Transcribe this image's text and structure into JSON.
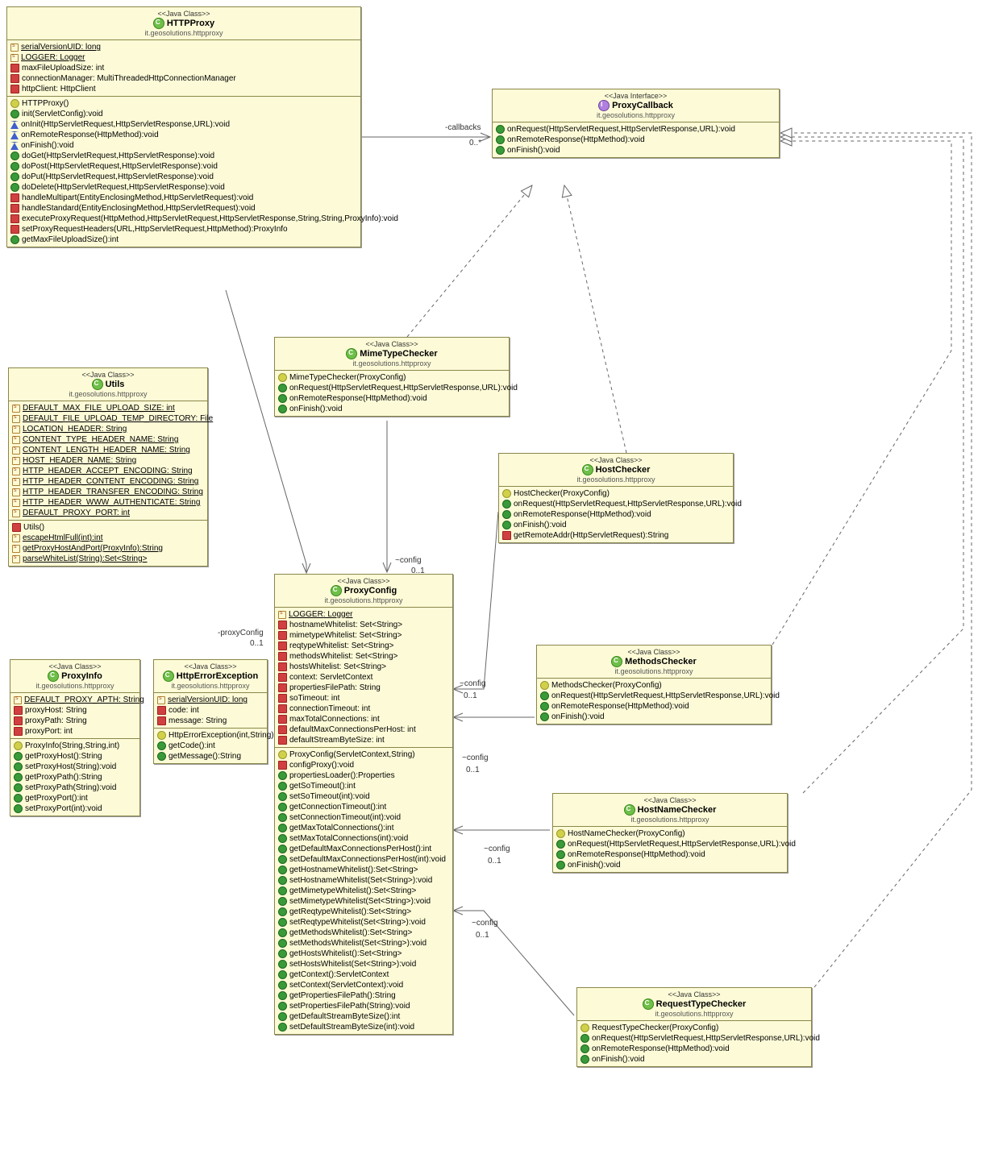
{
  "stereo_class": "<<Java Class>>",
  "stereo_intf": "<<Java Interface>>",
  "pkg": "it.geosolutions.httpproxy",
  "labels": {
    "callbacks": "-callbacks",
    "callbacks_mult": "0..*",
    "proxyConfig": "-proxyConfig",
    "proxyConfig_mult": "0..1",
    "config": "~config",
    "config_mult": "0..1"
  },
  "httpproxy": {
    "name": "HTTPProxy",
    "attrs": [
      {
        "i": "sf",
        "t": "serialVersionUID: long",
        "u": true
      },
      {
        "i": "sf",
        "t": "LOGGER: Logger",
        "u": true
      },
      {
        "i": "r",
        "t": "maxFileUploadSize: int"
      },
      {
        "i": "r",
        "t": "connectionManager: MultiThreadedHttpConnectionManager"
      },
      {
        "i": "r",
        "t": "httpClient: HttpClient"
      }
    ],
    "ops": [
      {
        "i": "yc",
        "t": "HTTPProxy()"
      },
      {
        "i": "g",
        "t": "init(ServletConfig):void"
      },
      {
        "i": "b",
        "t": "onInit(HttpServletRequest,HttpServletResponse,URL):void"
      },
      {
        "i": "b",
        "t": "onRemoteResponse(HttpMethod):void"
      },
      {
        "i": "b",
        "t": "onFinish():void"
      },
      {
        "i": "g",
        "t": "doGet(HttpServletRequest,HttpServletResponse):void"
      },
      {
        "i": "g",
        "t": "doPost(HttpServletRequest,HttpServletResponse):void"
      },
      {
        "i": "g",
        "t": "doPut(HttpServletRequest,HttpServletResponse):void"
      },
      {
        "i": "g",
        "t": "doDelete(HttpServletRequest,HttpServletResponse):void"
      },
      {
        "i": "r",
        "t": "handleMultipart(EntityEnclosingMethod,HttpServletRequest):void"
      },
      {
        "i": "r",
        "t": "handleStandard(EntityEnclosingMethod,HttpServletRequest):void"
      },
      {
        "i": "r",
        "t": "executeProxyRequest(HttpMethod,HttpServletRequest,HttpServletResponse,String,String,ProxyInfo):void"
      },
      {
        "i": "r",
        "t": "setProxyRequestHeaders(URL,HttpServletRequest,HttpMethod):ProxyInfo"
      },
      {
        "i": "g",
        "t": "getMaxFileUploadSize():int"
      }
    ]
  },
  "proxycallback": {
    "name": "ProxyCallback",
    "ops": [
      {
        "i": "g",
        "t": "onRequest(HttpServletRequest,HttpServletResponse,URL):void"
      },
      {
        "i": "g",
        "t": "onRemoteResponse(HttpMethod):void"
      },
      {
        "i": "g",
        "t": "onFinish():void"
      }
    ]
  },
  "utils": {
    "name": "Utils",
    "attrs": [
      {
        "i": "sf",
        "t": "DEFAULT_MAX_FILE_UPLOAD_SIZE: int",
        "u": true
      },
      {
        "i": "sf",
        "t": "DEFAULT_FILE_UPLOAD_TEMP_DIRECTORY: File",
        "u": true
      },
      {
        "i": "sf",
        "t": "LOCATION_HEADER: String",
        "u": true
      },
      {
        "i": "sf",
        "t": "CONTENT_TYPE_HEADER_NAME: String",
        "u": true
      },
      {
        "i": "sf",
        "t": "CONTENT_LENGTH_HEADER_NAME: String",
        "u": true
      },
      {
        "i": "sf",
        "t": "HOST_HEADER_NAME: String",
        "u": true
      },
      {
        "i": "sf",
        "t": "HTTP_HEADER_ACCEPT_ENCODING: String",
        "u": true
      },
      {
        "i": "sf",
        "t": "HTTP_HEADER_CONTENT_ENCODING: String",
        "u": true
      },
      {
        "i": "sf",
        "t": "HTTP_HEADER_TRANSFER_ENCODING: String",
        "u": true
      },
      {
        "i": "sf",
        "t": "HTTP_HEADER_WWW_AUTHENTICATE: String",
        "u": true
      },
      {
        "i": "sf",
        "t": "DEFAULT_PROXY_PORT: int",
        "u": true
      }
    ],
    "ops": [
      {
        "i": "r",
        "t": "Utils()"
      },
      {
        "i": "sf",
        "t": "escapeHtmlFull(int):int",
        "u": true
      },
      {
        "i": "sf",
        "t": "getProxyHostAndPort(ProxyInfo):String",
        "u": true
      },
      {
        "i": "sf",
        "t": "parseWhiteList(String):Set<String>",
        "u": true
      }
    ]
  },
  "mimetypechecker": {
    "name": "MimeTypeChecker",
    "ops": [
      {
        "i": "yc",
        "t": "MimeTypeChecker(ProxyConfig)"
      },
      {
        "i": "g",
        "t": "onRequest(HttpServletRequest,HttpServletResponse,URL):void"
      },
      {
        "i": "g",
        "t": "onRemoteResponse(HttpMethod):void"
      },
      {
        "i": "g",
        "t": "onFinish():void"
      }
    ]
  },
  "proxyconfig": {
    "name": "ProxyConfig",
    "attrs": [
      {
        "i": "sf",
        "t": "LOGGER: Logger",
        "u": true
      },
      {
        "i": "r",
        "t": "hostnameWhitelist: Set<String>"
      },
      {
        "i": "r",
        "t": "mimetypeWhitelist: Set<String>"
      },
      {
        "i": "r",
        "t": "reqtypeWhitelist: Set<String>"
      },
      {
        "i": "r",
        "t": "methodsWhitelist: Set<String>"
      },
      {
        "i": "r",
        "t": "hostsWhitelist: Set<String>"
      },
      {
        "i": "r",
        "t": "context: ServletContext"
      },
      {
        "i": "r",
        "t": "propertiesFilePath: String"
      },
      {
        "i": "r",
        "t": "soTimeout: int"
      },
      {
        "i": "r",
        "t": "connectionTimeout: int"
      },
      {
        "i": "r",
        "t": "maxTotalConnections: int"
      },
      {
        "i": "r",
        "t": "defaultMaxConnectionsPerHost: int"
      },
      {
        "i": "r",
        "t": "defaultStreamByteSize: int"
      }
    ],
    "ops": [
      {
        "i": "yc",
        "t": "ProxyConfig(ServletContext,String)"
      },
      {
        "i": "r",
        "t": "configProxy():void"
      },
      {
        "i": "g",
        "t": "propertiesLoader():Properties"
      },
      {
        "i": "g",
        "t": "getSoTimeout():int"
      },
      {
        "i": "g",
        "t": "setSoTimeout(int):void"
      },
      {
        "i": "g",
        "t": "getConnectionTimeout():int"
      },
      {
        "i": "g",
        "t": "setConnectionTimeout(int):void"
      },
      {
        "i": "g",
        "t": "getMaxTotalConnections():int"
      },
      {
        "i": "g",
        "t": "setMaxTotalConnections(int):void"
      },
      {
        "i": "g",
        "t": "getDefaultMaxConnectionsPerHost():int"
      },
      {
        "i": "g",
        "t": "setDefaultMaxConnectionsPerHost(int):void"
      },
      {
        "i": "g",
        "t": "getHostnameWhitelist():Set<String>"
      },
      {
        "i": "g",
        "t": "setHostnameWhitelist(Set<String>):void"
      },
      {
        "i": "g",
        "t": "getMimetypeWhitelist():Set<String>"
      },
      {
        "i": "g",
        "t": "setMimetypeWhitelist(Set<String>):void"
      },
      {
        "i": "g",
        "t": "getReqtypeWhitelist():Set<String>"
      },
      {
        "i": "g",
        "t": "setReqtypeWhitelist(Set<String>):void"
      },
      {
        "i": "g",
        "t": "getMethodsWhitelist():Set<String>"
      },
      {
        "i": "g",
        "t": "setMethodsWhitelist(Set<String>):void"
      },
      {
        "i": "g",
        "t": "getHostsWhitelist():Set<String>"
      },
      {
        "i": "g",
        "t": "setHostsWhitelist(Set<String>):void"
      },
      {
        "i": "g",
        "t": "getContext():ServletContext"
      },
      {
        "i": "g",
        "t": "setContext(ServletContext):void"
      },
      {
        "i": "g",
        "t": "getPropertiesFilePath():String"
      },
      {
        "i": "g",
        "t": "setPropertiesFilePath(String):void"
      },
      {
        "i": "g",
        "t": "getDefaultStreamByteSize():int"
      },
      {
        "i": "g",
        "t": "setDefaultStreamByteSize(int):void"
      }
    ]
  },
  "hostchecker": {
    "name": "HostChecker",
    "ops": [
      {
        "i": "yc",
        "t": "HostChecker(ProxyConfig)"
      },
      {
        "i": "g",
        "t": "onRequest(HttpServletRequest,HttpServletResponse,URL):void"
      },
      {
        "i": "g",
        "t": "onRemoteResponse(HttpMethod):void"
      },
      {
        "i": "g",
        "t": "onFinish():void"
      },
      {
        "i": "r",
        "t": "getRemoteAddr(HttpServletRequest):String"
      }
    ]
  },
  "methodschecker": {
    "name": "MethodsChecker",
    "ops": [
      {
        "i": "yc",
        "t": "MethodsChecker(ProxyConfig)"
      },
      {
        "i": "g",
        "t": "onRequest(HttpServletRequest,HttpServletResponse,URL):void"
      },
      {
        "i": "g",
        "t": "onRemoteResponse(HttpMethod):void"
      },
      {
        "i": "g",
        "t": "onFinish():void"
      }
    ]
  },
  "hostnamechecker": {
    "name": "HostNameChecker",
    "ops": [
      {
        "i": "yc",
        "t": "HostNameChecker(ProxyConfig)"
      },
      {
        "i": "g",
        "t": "onRequest(HttpServletRequest,HttpServletResponse,URL):void"
      },
      {
        "i": "g",
        "t": "onRemoteResponse(HttpMethod):void"
      },
      {
        "i": "g",
        "t": "onFinish():void"
      }
    ]
  },
  "requesttypechecker": {
    "name": "RequestTypeChecker",
    "ops": [
      {
        "i": "yc",
        "t": "RequestTypeChecker(ProxyConfig)"
      },
      {
        "i": "g",
        "t": "onRequest(HttpServletRequest,HttpServletResponse,URL):void"
      },
      {
        "i": "g",
        "t": "onRemoteResponse(HttpMethod):void"
      },
      {
        "i": "g",
        "t": "onFinish():void"
      }
    ]
  },
  "proxyinfo": {
    "name": "ProxyInfo",
    "attrs": [
      {
        "i": "sf",
        "t": "DEFAULT_PROXY_APTH: String",
        "u": true
      },
      {
        "i": "r",
        "t": "proxyHost: String"
      },
      {
        "i": "r",
        "t": "proxyPath: String"
      },
      {
        "i": "r",
        "t": "proxyPort: int"
      }
    ],
    "ops": [
      {
        "i": "yc",
        "t": "ProxyInfo(String,String,int)"
      },
      {
        "i": "g",
        "t": "getProxyHost():String"
      },
      {
        "i": "g",
        "t": "setProxyHost(String):void"
      },
      {
        "i": "g",
        "t": "getProxyPath():String"
      },
      {
        "i": "g",
        "t": "setProxyPath(String):void"
      },
      {
        "i": "g",
        "t": "getProxyPort():int"
      },
      {
        "i": "g",
        "t": "setProxyPort(int):void"
      }
    ]
  },
  "httperrorexception": {
    "name": "HttpErrorException",
    "attrs": [
      {
        "i": "sf",
        "t": "serialVersionUID: long",
        "u": true
      },
      {
        "i": "r",
        "t": "code: int"
      },
      {
        "i": "r",
        "t": "message: String"
      }
    ],
    "ops": [
      {
        "i": "yc",
        "t": "HttpErrorException(int,String)"
      },
      {
        "i": "g",
        "t": "getCode():int"
      },
      {
        "i": "g",
        "t": "getMessage():String"
      }
    ]
  }
}
